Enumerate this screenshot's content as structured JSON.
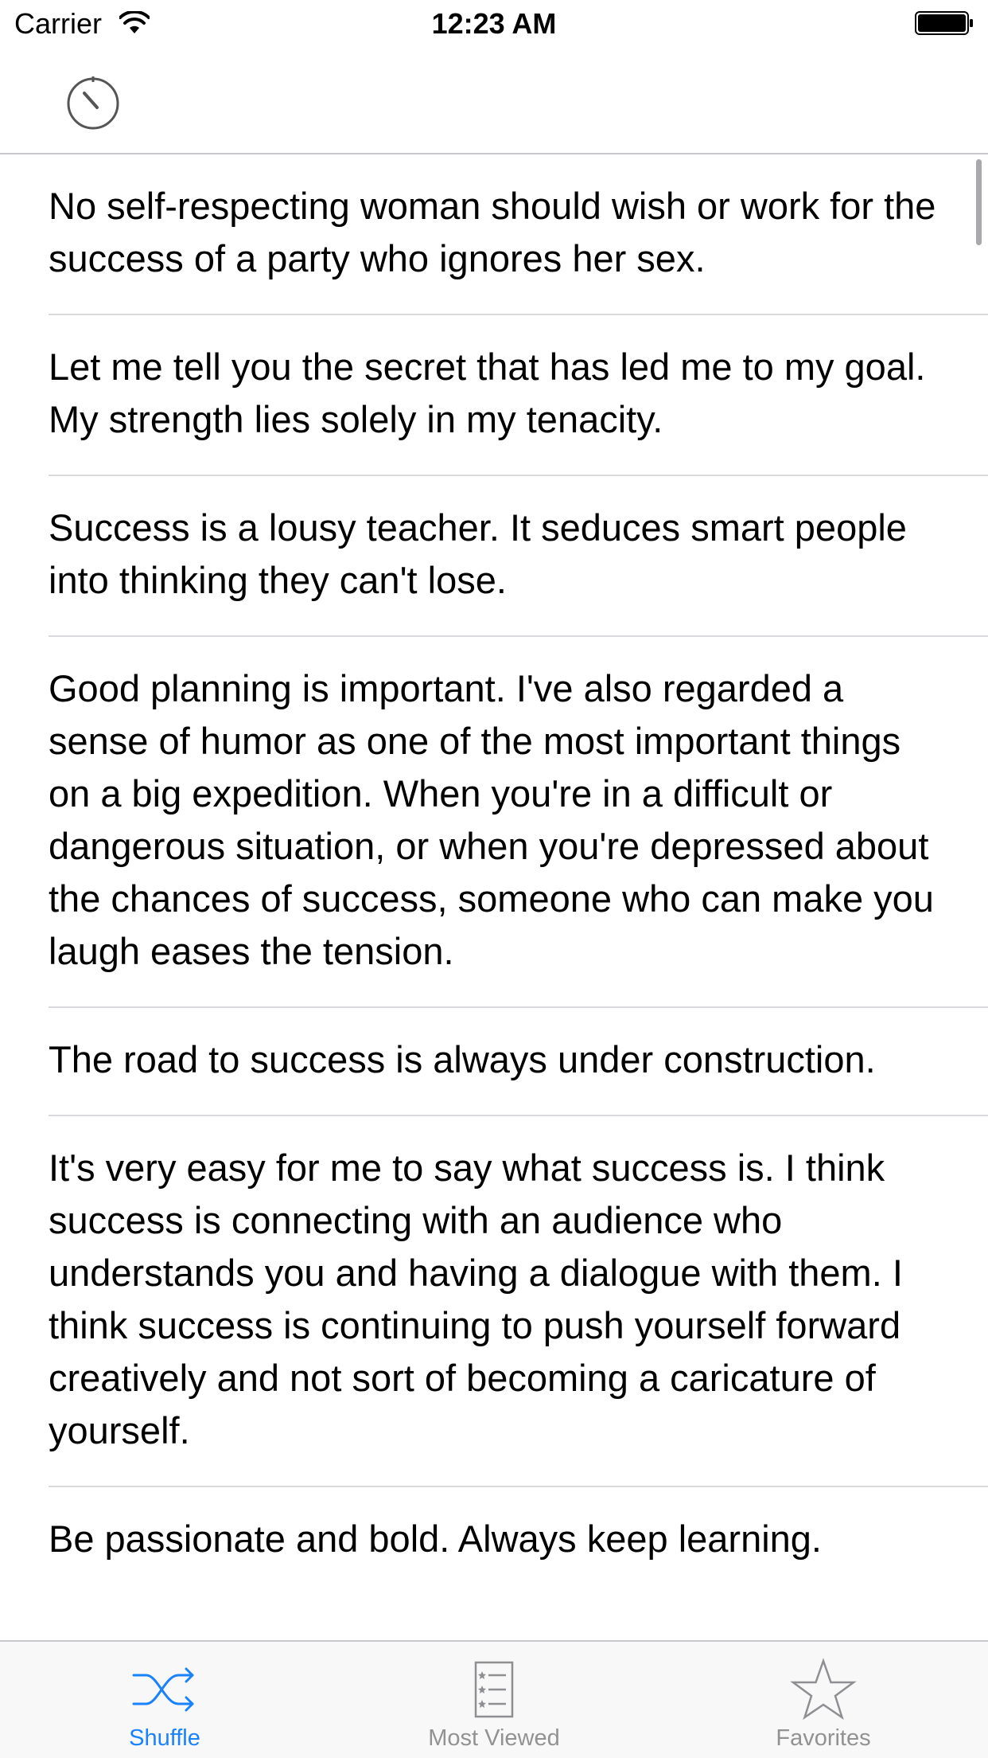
{
  "status_bar": {
    "carrier": "Carrier",
    "time": "12:23 AM"
  },
  "nav_bar": {
    "timer_icon": "stopwatch-icon"
  },
  "quotes": [
    "No self-respecting woman should wish or work for the success of a party who ignores her sex.",
    "Let me tell you the secret that has led me to my goal. My strength lies solely in my tenacity.",
    "Success is a lousy teacher. It seduces smart people into thinking they can't lose.",
    "Good planning is important. I've also regarded a sense of humor as one of the most important things on a big expedition. When you're in a difficult or dangerous situation, or when you're depressed about the chances of success, someone who can make you laugh eases the tension.",
    "The road to success is always under construction.",
    "It's very easy for me to say what success is. I think success is connecting with an audience who understands you and having a dialogue with them. I think success is continuing to push yourself forward creatively and not sort of becoming a caricature of yourself.",
    "Be passionate and bold. Always keep learning."
  ],
  "tab_bar": {
    "tabs": [
      {
        "label": "Shuffle",
        "icon": "shuffle-icon",
        "active": true
      },
      {
        "label": "Most Viewed",
        "icon": "list-icon",
        "active": false
      },
      {
        "label": "Favorites",
        "icon": "star-icon",
        "active": false
      }
    ]
  },
  "colors": {
    "accent": "#1a82fb",
    "inactive": "#929292",
    "separator": "#c8c7cc"
  }
}
